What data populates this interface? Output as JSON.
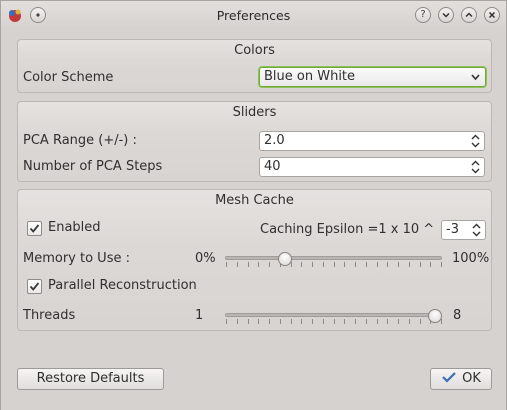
{
  "window": {
    "title": "Preferences"
  },
  "colors_group": {
    "title": "Colors",
    "color_scheme_label": "Color Scheme",
    "color_scheme_value": "Blue on White"
  },
  "sliders_group": {
    "title": "Sliders",
    "pca_range_label": "PCA Range (+/-) :",
    "pca_range_value": "2.0",
    "pca_steps_label": "Number of PCA Steps",
    "pca_steps_value": "40"
  },
  "mesh_cache_group": {
    "title": "Mesh Cache",
    "enabled_label": "Enabled",
    "enabled_checked": true,
    "caching_epsilon_label": "Caching Epsilon =1  x 10 ^",
    "caching_epsilon_value": "-3",
    "memory_label": "Memory to Use :",
    "memory_min_label": "0%",
    "memory_max_label": "100%",
    "memory_fraction": 0.26,
    "parallel_label": "Parallel Reconstruction",
    "parallel_checked": true,
    "threads_label": "Threads",
    "threads_min_label": "1",
    "threads_max_label": "8",
    "threads_fraction": 1.0
  },
  "footer": {
    "restore_label": "Restore Defaults",
    "ok_label": "OK"
  },
  "colors": {
    "focus_accent": "#71a83c",
    "ok_check": "#3a6fb5"
  }
}
